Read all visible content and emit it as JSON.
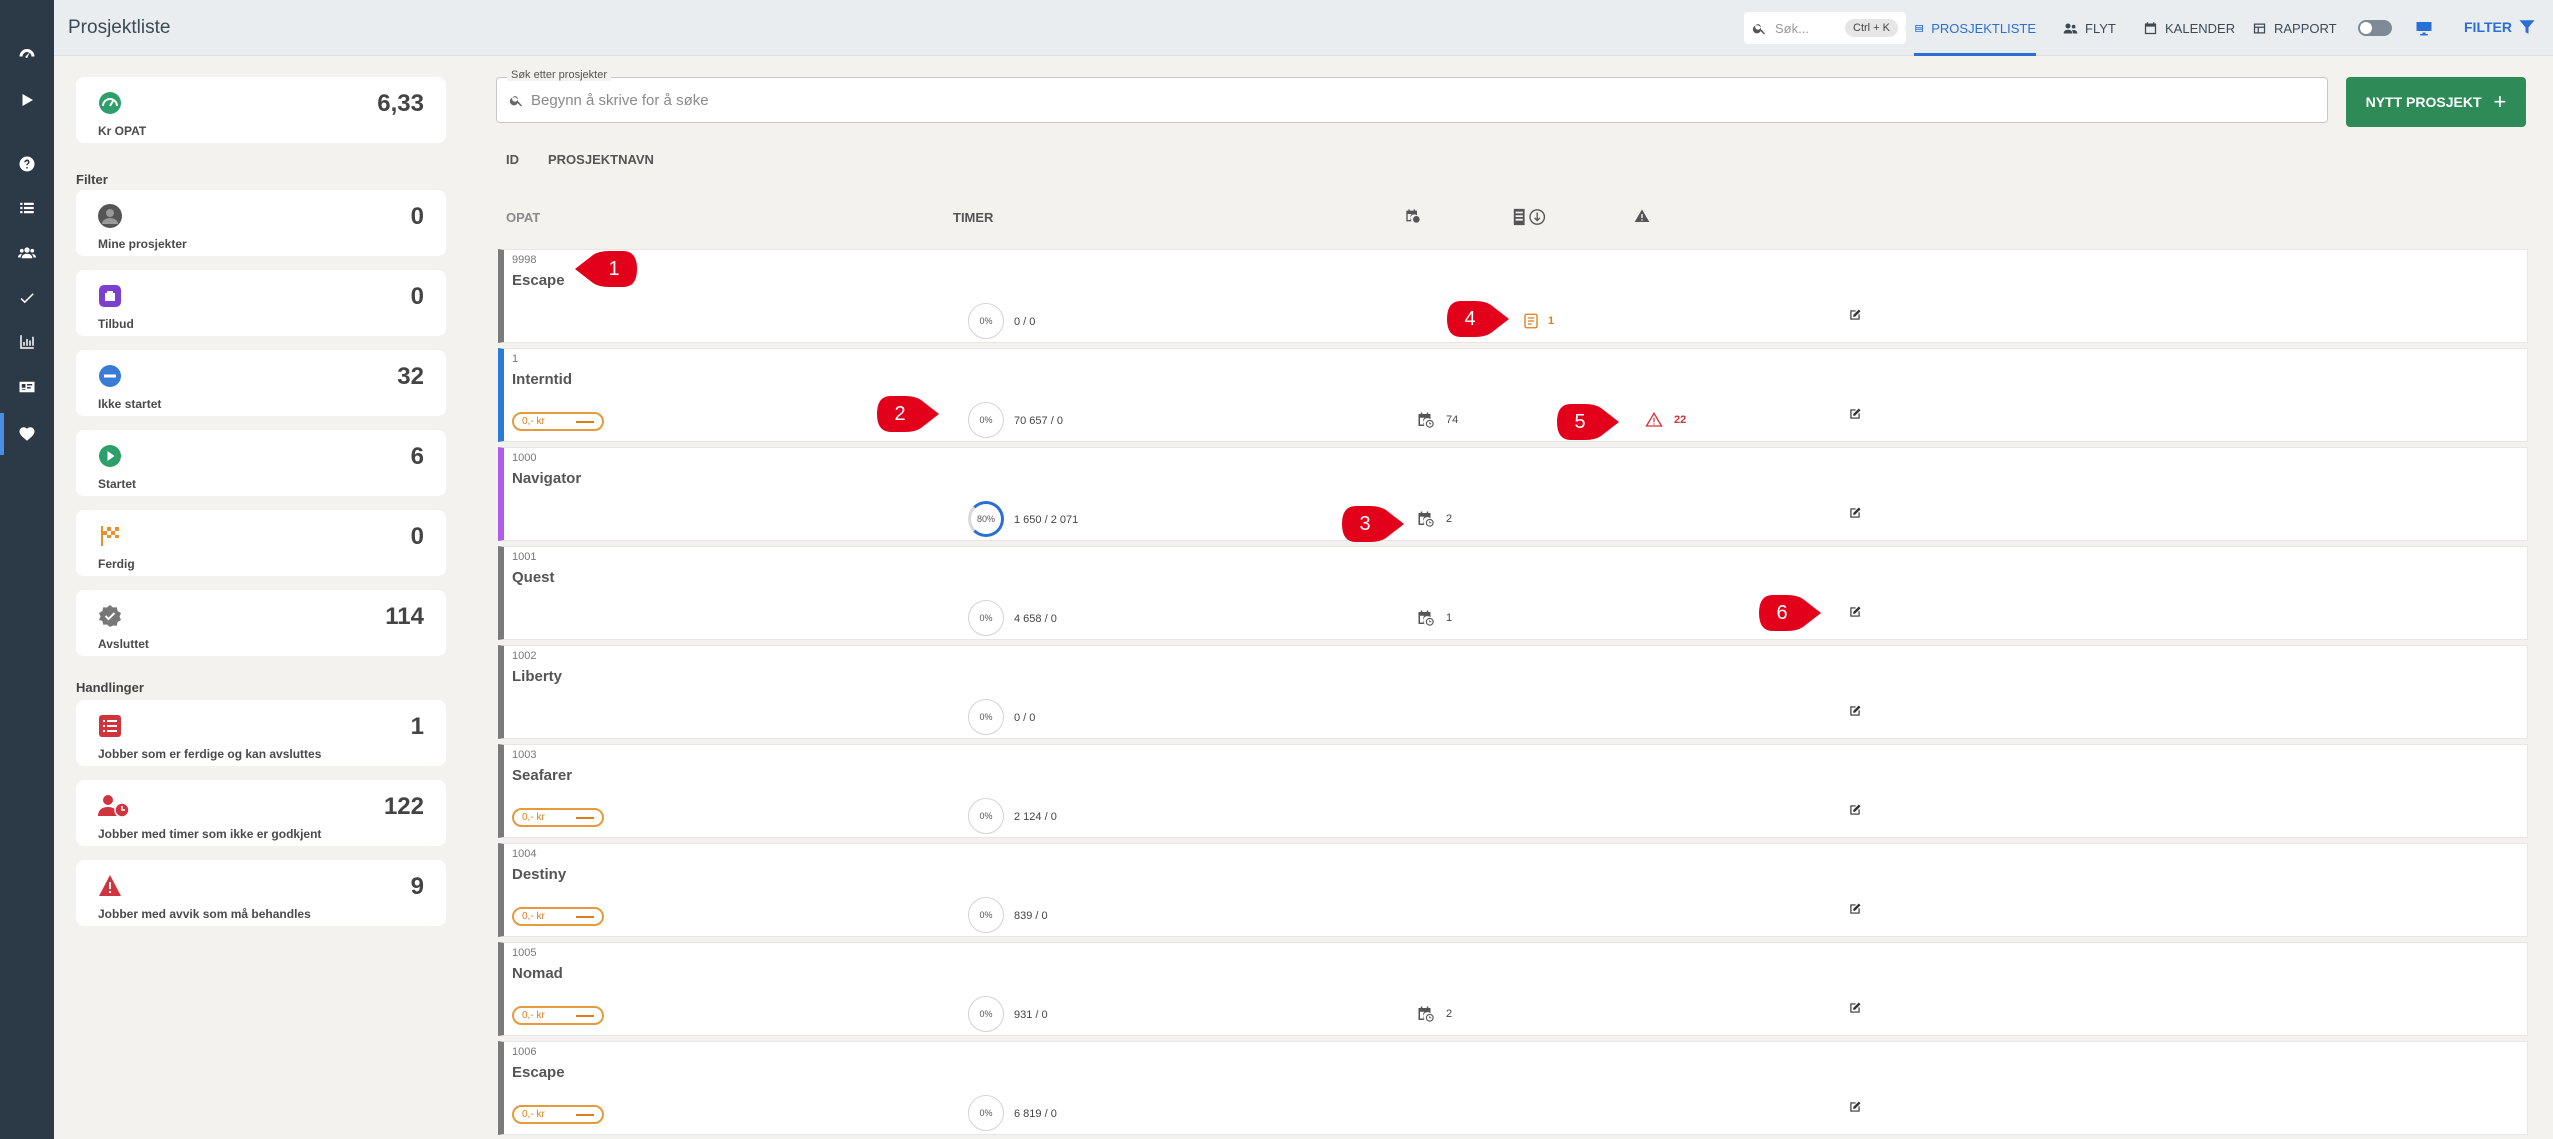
{
  "header": {
    "title": "Prosjektliste",
    "search_placeholder": "Søk...",
    "search_shortcut": "Ctrl + K",
    "tabs": [
      {
        "label": "PROSJEKTLISTE",
        "icon": "list-table-icon",
        "active": true
      },
      {
        "label": "FLYT",
        "icon": "people-icon",
        "active": false
      },
      {
        "label": "KALENDER",
        "icon": "calendar-icon",
        "active": false
      },
      {
        "label": "RAPPORT",
        "icon": "report-icon",
        "active": false
      }
    ],
    "filter_label": "FILTER"
  },
  "rail": {
    "icons": [
      "dashboard-icon",
      "play-icon",
      "help-icon",
      "list-icon",
      "users-icon",
      "check-icon",
      "chart-icon",
      "id-card-icon",
      "heart-icon"
    ]
  },
  "left_panel": {
    "opat": {
      "value": "6,33",
      "label": "Kr OPAT"
    },
    "filter_heading": "Filter",
    "filters": [
      {
        "label": "Mine prosjekter",
        "value": "0",
        "icon": "avatar-icon"
      },
      {
        "label": "Tilbud",
        "value": "0",
        "icon": "offer-icon"
      },
      {
        "label": "Ikke startet",
        "value": "32",
        "icon": "not-started-icon"
      },
      {
        "label": "Startet",
        "value": "6",
        "icon": "started-icon"
      },
      {
        "label": "Ferdig",
        "value": "0",
        "icon": "finish-flag-icon"
      },
      {
        "label": "Avsluttet",
        "value": "114",
        "icon": "closed-badge-icon"
      }
    ],
    "actions_heading": "Handlinger",
    "actions": [
      {
        "label": "Jobber som er ferdige og kan avsluttes",
        "value": "1",
        "icon": "checklist-icon"
      },
      {
        "label": "Jobber med timer som ikke er godkjent",
        "value": "122",
        "icon": "user-clock-icon"
      },
      {
        "label": "Jobber med avvik som må behandles",
        "value": "9",
        "icon": "warning-icon"
      }
    ]
  },
  "main": {
    "search_legend": "Søk etter prosjekter",
    "search_placeholder": "Begynn å skrive for å søke",
    "new_project_label": "NYTT PROSJEKT",
    "columns": {
      "id": "ID",
      "name": "PROSJEKTNAVN",
      "opat": "OPAT",
      "hours": "TIMER"
    },
    "colors": {
      "accent": "#2a6fd6",
      "new_project": "#2e8b57",
      "opat_badge": "#e07b1a",
      "warning": "#d0343f",
      "marker": "#e3001b"
    },
    "projects": [
      {
        "id": "9998",
        "name": "Escape",
        "bar_color": "#7a7a7a",
        "opat": "",
        "percent": "0%",
        "progress": 0,
        "hours": "0 / 0",
        "calendar": "",
        "docs": "1",
        "warnings": ""
      },
      {
        "id": "1",
        "name": "Interntid",
        "bar_color": "#2a7ad6",
        "opat": "0,- kr",
        "percent": "0%",
        "progress": 0,
        "hours": "70 657 / 0",
        "calendar": "74",
        "docs": "",
        "warnings": "22"
      },
      {
        "id": "1000",
        "name": "Navigator",
        "bar_color": "#b05ce6",
        "opat": "",
        "percent": "80%",
        "progress": 0.8,
        "hours": "1 650 / 2 071",
        "calendar": "2",
        "docs": "",
        "warnings": ""
      },
      {
        "id": "1001",
        "name": "Quest",
        "bar_color": "#7a7a7a",
        "opat": "",
        "percent": "0%",
        "progress": 0,
        "hours": "4 658 / 0",
        "calendar": "1",
        "docs": "",
        "warnings": ""
      },
      {
        "id": "1002",
        "name": "Liberty",
        "bar_color": "#7a7a7a",
        "opat": "",
        "percent": "0%",
        "progress": 0,
        "hours": "0 / 0",
        "calendar": "",
        "docs": "",
        "warnings": ""
      },
      {
        "id": "1003",
        "name": "Seafarer",
        "bar_color": "#7a7a7a",
        "opat": "0,- kr",
        "percent": "0%",
        "progress": 0,
        "hours": "2 124 / 0",
        "calendar": "",
        "docs": "",
        "warnings": ""
      },
      {
        "id": "1004",
        "name": "Destiny",
        "bar_color": "#7a7a7a",
        "opat": "0,- kr",
        "percent": "0%",
        "progress": 0,
        "hours": "839 / 0",
        "calendar": "",
        "docs": "",
        "warnings": ""
      },
      {
        "id": "1005",
        "name": "Nomad",
        "bar_color": "#7a7a7a",
        "opat": "0,- kr",
        "percent": "0%",
        "progress": 0,
        "hours": "931 / 0",
        "calendar": "2",
        "docs": "",
        "warnings": ""
      },
      {
        "id": "1006",
        "name": "Escape",
        "bar_color": "#7a7a7a",
        "opat": "0,- kr",
        "percent": "0%",
        "progress": 0,
        "hours": "6 819 / 0",
        "calendar": "",
        "docs": "",
        "warnings": ""
      }
    ]
  },
  "markers": [
    "1",
    "2",
    "3",
    "4",
    "5",
    "6"
  ]
}
